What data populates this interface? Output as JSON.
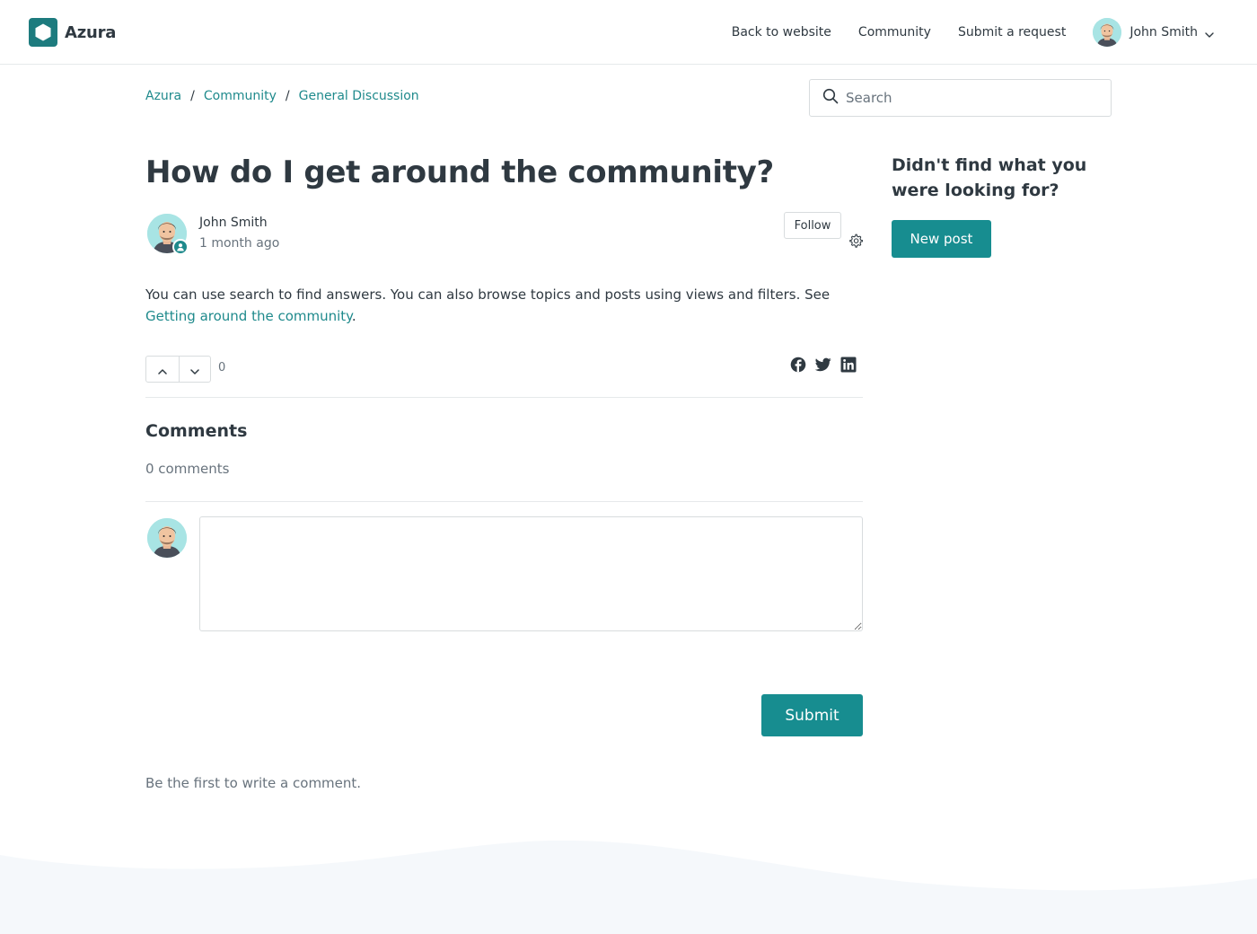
{
  "colors": {
    "brand": "#1d7b7e",
    "accent": "#178d90",
    "link": "#1f8a8c",
    "text": "#2f3941",
    "muted": "#68737d",
    "border": "#d8dcde",
    "footer_wave": "#f5f8fb"
  },
  "header": {
    "logo_icon": "hexagon-logo-icon",
    "brand_name": "Azura",
    "nav": [
      {
        "label": "Back to website"
      },
      {
        "label": "Community"
      },
      {
        "label": "Submit a request"
      }
    ],
    "user": {
      "name": "John Smith",
      "avatar": "user-avatar",
      "menu_icon": "chevron-down-icon"
    }
  },
  "breadcrumb": [
    "Azura",
    "Community",
    "General Discussion"
  ],
  "search": {
    "placeholder": "Search",
    "icon": "search-icon"
  },
  "post": {
    "title": "How do I get around the community?",
    "author": "John Smith",
    "timestamp": "1 month ago",
    "author_badge_icon": "user-badge-icon",
    "follow_label": "Follow",
    "settings_icon": "gear-icon",
    "body_text": "You can use search to find answers. You can also browse topics and posts using views and filters. See ",
    "body_link": "Getting around the community",
    "body_end": ".",
    "vote_count": "0",
    "vote_up_icon": "chevron-up-icon",
    "vote_down_icon": "chevron-down-icon",
    "share_icons": [
      "facebook-icon",
      "twitter-icon",
      "linkedin-icon"
    ]
  },
  "comments": {
    "title": "Comments",
    "count_label": "0 comments",
    "submit_label": "Submit",
    "empty_message": "Be the first to write a comment."
  },
  "sidebar": {
    "title": "Didn't find what you were looking for?",
    "new_post_label": "New post"
  }
}
